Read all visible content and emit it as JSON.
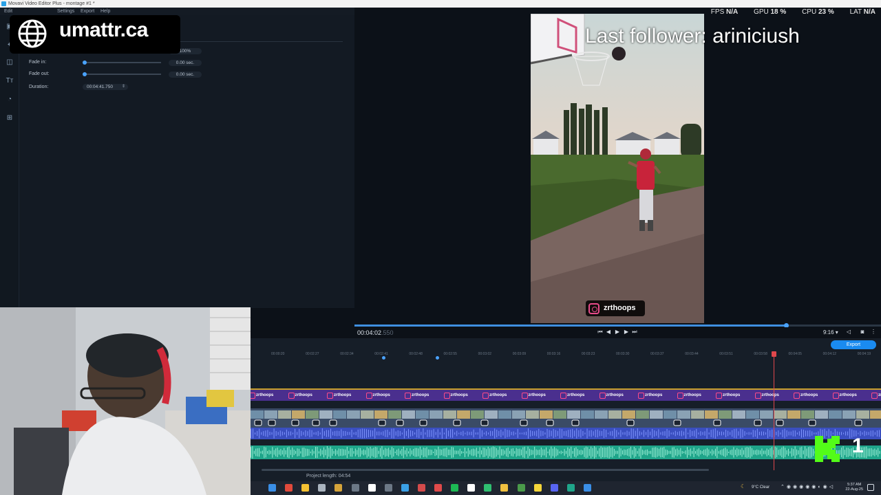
{
  "window": {
    "title": "Movavi Video Editor Plus - montage #1 *"
  },
  "menu": {
    "items": [
      "Edit",
      "Settings",
      "Export",
      "Help"
    ]
  },
  "perf": {
    "fps_label": "FPS",
    "fps": "N/A",
    "gpu_label": "GPU",
    "gpu": "18 %",
    "cpu_label": "CPU",
    "cpu": "23 %",
    "lat_label": "LAT",
    "lat": "N/A"
  },
  "watermark": {
    "text": "umattr.ca"
  },
  "properties": {
    "volume_value": "100%",
    "volume_level": 1.0,
    "fade_in_label": "Fade in:",
    "fade_in_value": "0.00 sec.",
    "fade_out_label": "Fade out:",
    "fade_out_value": "0.00 sec.",
    "duration_label": "Duration:",
    "duration_value": "00:04:41.750"
  },
  "overlay": {
    "follower_text": "Last follower: ariniciush",
    "ig_handle": "zrthoops"
  },
  "player": {
    "timecode": "00:04:02",
    "timecode_ms": ".550",
    "aspect": "9:16",
    "progress": 0.82
  },
  "timeline": {
    "export_label": "Export",
    "ruler_ticks": [
      "00:00:20",
      "00:02:27",
      "00:02:34",
      "00:02:41",
      "00:02:48",
      "00:02:55",
      "00:03:02",
      "00:03:09",
      "00:03:16",
      "00:03:23",
      "00:03:30",
      "00:03:37",
      "00:03:44",
      "00:03:51",
      "00:03:58",
      "00:04:05",
      "00:04:12",
      "00:04:19"
    ],
    "title_clip_label": "zrthoops",
    "project_length_label": "Project length: 04:54",
    "badge_number": "1"
  },
  "taskbar": {
    "weather": "9°C Clear",
    "time": "5:37 AM",
    "date": "22-Aug-25"
  },
  "colors": {
    "accent": "#1a8bf0",
    "playhead": "#e0474c",
    "title_track": "#4a2f8e",
    "music_track": "#1fa58a",
    "kick_green": "#53fc18"
  }
}
